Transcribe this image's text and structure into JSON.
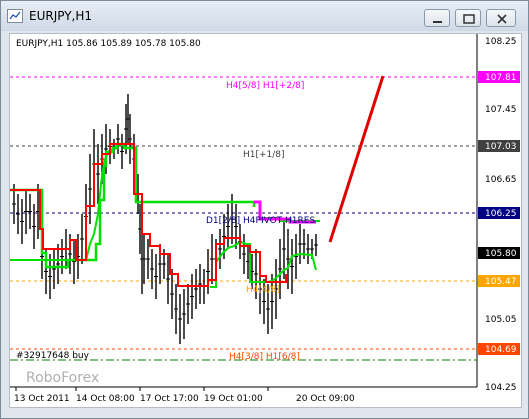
{
  "window": {
    "title": "EURJPY,H1",
    "buttons": [
      "minimize",
      "restore",
      "close"
    ]
  },
  "chart": {
    "info_line": "EURJPY,H1  105.86 105.89 105.78 105.80",
    "watermark": "RoboForex",
    "order_label": "#32917648 buy",
    "price_labels": {
      "p1": "108.25",
      "p2": "107.81",
      "p3": "107.45",
      "p4": "107.03",
      "p5": "106.65",
      "p6": "106.25",
      "p7": "105.80",
      "p8": "105.47",
      "p9": "105.05",
      "p10": "104.69",
      "p11": "104.25"
    },
    "level_labels": {
      "h4_58": "H4[5/8] H1[+2/8]",
      "h1_18": "H1[+1/8]",
      "pivot": "D1[2/8] H4PIVOT H1RES",
      "h4_48": "H4[4/8]",
      "h4_38": "H4[3/8] H1[6/8]"
    },
    "time_labels": {
      "t1": "13 Oct 2011",
      "t2": "14 Oct 08:00",
      "t3": "17 Oct 17:00",
      "t4": "19 Oct 01:00",
      "t5": "20 Oct 09:00"
    },
    "colors": {
      "magenta": "#ff00ff",
      "dark_gray": "#404040",
      "navy": "#000080",
      "orange": "#ffa500",
      "orange_red": "#ff4500",
      "current_price_bg": "#000000",
      "green_line": "#00e000",
      "red_line": "#ff0000",
      "order_line": "#008000"
    }
  }
}
